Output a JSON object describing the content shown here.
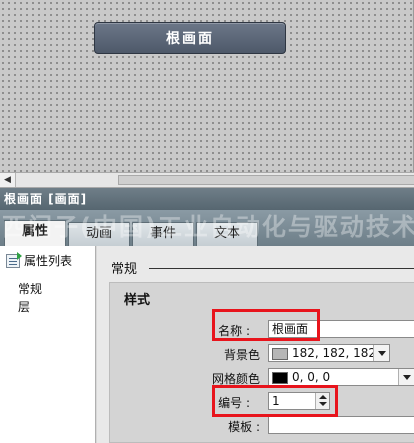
{
  "canvas": {
    "button_label": "根画面"
  },
  "inspector": {
    "title": "根画面 [画面]",
    "tabs": [
      "属性",
      "动画",
      "事件",
      "文本"
    ],
    "watermark": "西门子(中国)工业自动化与驱动技术服务公司"
  },
  "left_panel": {
    "header": "属性列表",
    "items": [
      "常规",
      "层"
    ]
  },
  "right_panel": {
    "section": "常规",
    "group_title": "样式",
    "fields": {
      "name": {
        "label": "名称",
        "value": "根画面"
      },
      "background": {
        "label": "背景色",
        "value": "182, 182, 182",
        "swatch": "#b6b6b6"
      },
      "grid_color": {
        "label": "网格颜色",
        "value": "0, 0, 0",
        "swatch": "#000000"
      },
      "number": {
        "label": "编号",
        "value": "1"
      },
      "template": {
        "label": "模板",
        "value": ""
      }
    }
  },
  "colors": {
    "highlight": "#e8141c",
    "header": "#566670"
  }
}
